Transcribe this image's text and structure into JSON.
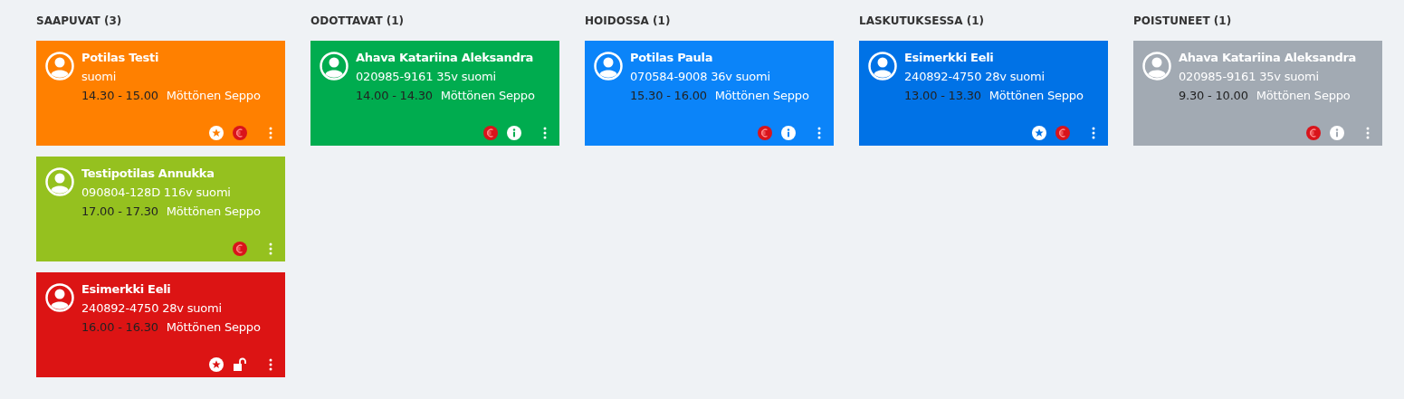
{
  "columns": [
    {
      "title": "SAAPUVAT (3)",
      "cards": [
        {
          "name": "Potilas Testi",
          "details": "suomi",
          "time": "14.30 - 15.00",
          "doctor": "Möttönen Seppo",
          "color": "#ff8000",
          "icons": [
            {
              "kind": "star"
            },
            {
              "kind": "euro"
            }
          ]
        },
        {
          "name": "Testipotilas Annukka",
          "details": "090804-128D 116v suomi",
          "time": "17.00 - 17.30",
          "doctor": "Möttönen Seppo",
          "color": "#95c11f",
          "icons": [
            {
              "kind": "euro"
            }
          ]
        },
        {
          "name": "Esimerkki Eeli",
          "details": "240892-4750 28v suomi",
          "time": "16.00 - 16.30",
          "doctor": "Möttönen Seppo",
          "color": "#dc1414",
          "icons": [
            {
              "kind": "star"
            },
            {
              "kind": "lock"
            }
          ]
        }
      ]
    },
    {
      "title": "ODOTTAVAT (1)",
      "cards": [
        {
          "name": "Ahava Katariina Aleksandra",
          "details": "020985-9161 35v suomi",
          "time": "14.00 - 14.30",
          "doctor": "Möttönen Seppo",
          "color": "#00ac4f",
          "icons": [
            {
              "kind": "euro"
            },
            {
              "kind": "info"
            }
          ]
        }
      ]
    },
    {
      "title": "HOIDOSSA (1)",
      "cards": [
        {
          "name": "Potilas Paula",
          "details": "070584-9008 36v suomi",
          "time": "15.30 - 16.00",
          "doctor": "Möttönen Seppo",
          "color": "#0b84f9",
          "icons": [
            {
              "kind": "euro"
            },
            {
              "kind": "info"
            }
          ]
        }
      ]
    },
    {
      "title": "LASKUTUKSESSA (1)",
      "cards": [
        {
          "name": "Esimerkki Eeli",
          "details": "240892-4750 28v suomi",
          "time": "13.00 - 13.30",
          "doctor": "Möttönen Seppo",
          "color": "#0072e6",
          "icons": [
            {
              "kind": "star"
            },
            {
              "kind": "euro"
            }
          ]
        }
      ]
    },
    {
      "title": "POISTUNEET (1)",
      "cards": [
        {
          "name": "Ahava Katariina Aleksandra",
          "details": "020985-9161 35v suomi",
          "time": "9.30 - 10.00",
          "doctor": "Möttönen Seppo",
          "color": "#a2aab3",
          "icons": [
            {
              "kind": "euro"
            },
            {
              "kind": "info"
            }
          ]
        }
      ]
    }
  ]
}
